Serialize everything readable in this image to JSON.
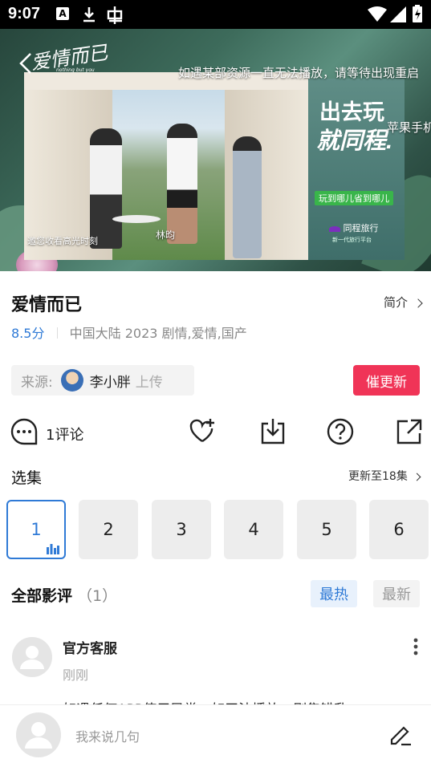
{
  "status_bar": {
    "time": "9:07"
  },
  "player": {
    "watermark": "爱情而已",
    "watermark_sub": "nothing but you",
    "notice": "如遇某部资源一直无法播放，请等待出现重启",
    "side_text": "苹果手机",
    "subtitle": "林昀",
    "caption": "邀您收看高光时刻",
    "ad": {
      "line1": "出去玩",
      "line2": "就同程.",
      "pill": "玩到哪儿省到哪儿",
      "brand": "同程旅行",
      "brand_sub": "新一代旅行平台"
    }
  },
  "show": {
    "title": "爱情而已",
    "intro_label": "简介",
    "rating": "8.5分",
    "meta": "中国大陆  2023  剧情,爱情,国产"
  },
  "source": {
    "label": "来源:",
    "uploader": "李小胖",
    "suffix": "上传",
    "urge_button": "催更新"
  },
  "actions": {
    "comments": "1评论"
  },
  "episodes": {
    "title": "选集",
    "update_info": "更新至18集",
    "items": [
      "1",
      "2",
      "3",
      "4",
      "5",
      "6"
    ],
    "active": "1"
  },
  "reviews": {
    "title": "全部影评",
    "count": "（1）",
    "sort_hot": "最热",
    "sort_new": "最新",
    "items": [
      {
        "author": "官方客服",
        "time": "刚刚",
        "text": "如遇任何APP使用异常，如无法播放，剧集错乱"
      }
    ]
  },
  "comment_bar": {
    "placeholder": "我来说几句"
  },
  "colors": {
    "accent": "#2f7ad6",
    "urge": "#f03457",
    "hot_bg": "#e8f1fc"
  }
}
